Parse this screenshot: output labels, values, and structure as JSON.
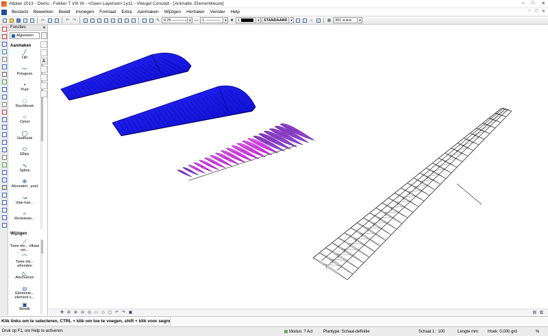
{
  "window": {
    "title": "Allplan 2013 - Demo - Fokker T VIII W - <Geen Layerset>:Ly11 - Vleugel Concept - [Animatie: Elementkeuze]",
    "controls": [
      "–",
      "□",
      "✕"
    ]
  },
  "menu": {
    "items": [
      "Bestand",
      "Bewerken",
      "Beeld",
      "Invoegen",
      "Formaat",
      "Extra",
      "Aanmaken",
      "Wijzigen",
      "Herhalen",
      "Venster",
      "Help"
    ]
  },
  "toolbar": {
    "pen_thickness": "0.25",
    "line_type": "1",
    "color": "1",
    "color_swatch": "#000000",
    "layer": "STANDAARD",
    "hatch_number": "301"
  },
  "panel": {
    "title": "Functies",
    "close": "✕",
    "category": "Algemeen",
    "section_create": "Aanmaken",
    "section_modify": "Wijzigen",
    "create_items": [
      "Lijn",
      "Polygoon",
      "Punt",
      "Rechthoek",
      "Cirkel",
      "Veelhoek",
      "Ellips",
      "Spline",
      "Afzonderl.. punt",
      "Vrije-han...",
      "Revisiewo..."
    ],
    "modify_items": [
      "Twee ele... elkaar ver...",
      "Twee ele... afronden",
      "Afschuinen",
      "Elemente... element s...",
      "Bereik"
    ],
    "sub_icons": [
      "A"
    ]
  },
  "prompt": {
    "text": "Klik links om te selecteren, CTRL + klik om toe te voegen, shift + klik voor segmentkeuze"
  },
  "status": {
    "help": "Druk op F1, om Help te activeren.",
    "mode_label": "Modus:",
    "mode_value": "? Act",
    "plantype_label": "Plantype:",
    "plantype_value": "Schaal-definitie",
    "scale_label": "Schaal",
    "scale_value": "1 : 100",
    "length_label": "Lengte",
    "length_value": "mm",
    "angle_label": "Hoek:",
    "angle_value": "0.000",
    "angle_unit": "grd",
    "percent": "%"
  },
  "colors": {
    "wing_blue": "#1010e0",
    "wing_blue_dark": "#000066",
    "rib_magenta": "#e030f0",
    "rib_purple": "#8040c0",
    "wireframe": "#222222"
  }
}
